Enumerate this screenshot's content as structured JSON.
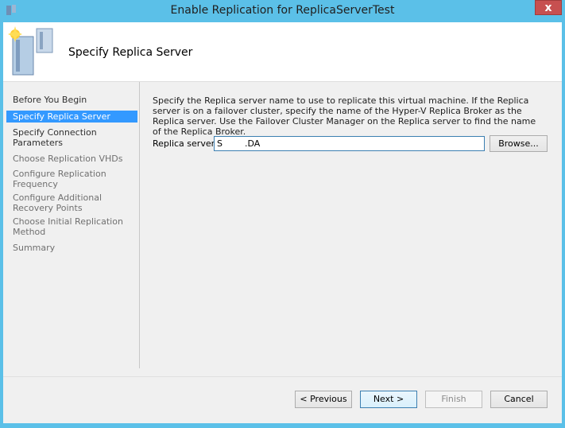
{
  "window": {
    "title": "Enable Replication for ReplicaServerTest",
    "close_label": "x"
  },
  "header": {
    "title": "Specify Replica Server"
  },
  "nav": {
    "items": [
      {
        "label": "Before You Begin",
        "state": "normal"
      },
      {
        "label": "Specify Replica Server",
        "state": "selected"
      },
      {
        "label": "Specify Connection Parameters",
        "state": "normal"
      },
      {
        "label": "Choose Replication VHDs",
        "state": "dim"
      },
      {
        "label": "Configure Replication Frequency",
        "state": "dim"
      },
      {
        "label": "Configure Additional Recovery Points",
        "state": "dim"
      },
      {
        "label": "Choose Initial Replication Method",
        "state": "dim"
      },
      {
        "label": "Summary",
        "state": "dim"
      }
    ]
  },
  "main": {
    "description": "Specify the Replica server name to use to replicate this virtual machine. If the Replica server is on a failover cluster, specify the name of the Hyper-V Replica Broker as the Replica server. Use the Failover Cluster Manager on the Replica server to find the name of the Replica Broker.",
    "replica_server_label": "Replica server:",
    "replica_server_value": "S        .DA",
    "browse_label": "Browse..."
  },
  "footer": {
    "previous_label": "< Previous",
    "next_label": "Next >",
    "finish_label": "Finish",
    "cancel_label": "Cancel"
  },
  "colors": {
    "window_frame": "#5bc0e8",
    "selection": "#3399ff",
    "close_button": "#c75050"
  }
}
